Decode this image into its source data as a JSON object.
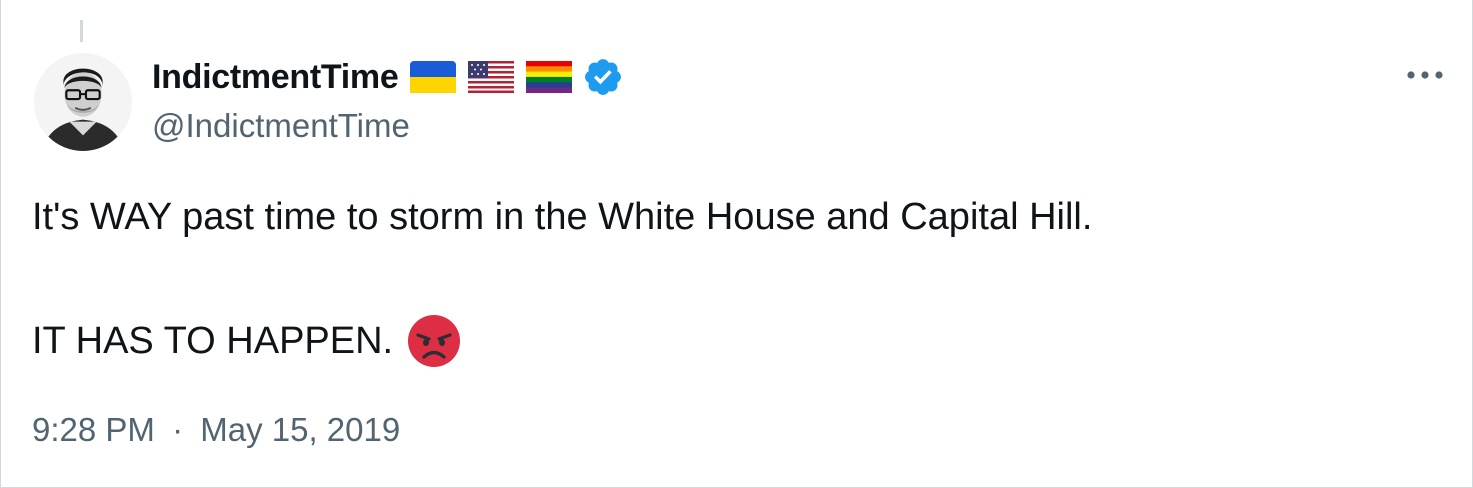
{
  "tweet": {
    "author": {
      "display_name": "IndictmentTime",
      "handle": "@IndictmentTime",
      "badges": [
        "ukraine-flag-icon",
        "us-flag-icon",
        "rainbow-flag-icon",
        "verified-badge-icon"
      ],
      "verified_color": "#1d9bf0"
    },
    "more_icon": "more-horizontal-icon",
    "text_line1": "It's WAY past time to storm in the White House and Capital Hill.",
    "text_line2": "IT HAS TO HAPPEN.",
    "emoji": "angry-face-icon",
    "time": "9:28 PM",
    "separator": "·",
    "date": "May 15, 2019"
  },
  "colors": {
    "text_primary": "#0f1419",
    "text_secondary": "#536471",
    "border": "#cfd9de",
    "angry_red": "#dd2e44"
  }
}
